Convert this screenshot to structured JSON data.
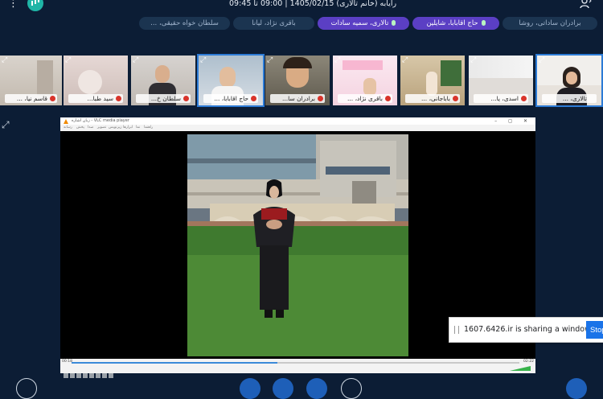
{
  "header": {
    "session_title": "رایابه (خانم تالاری) 1405/02/15 | 09:00 تا 09:45",
    "menu_icon": "more-vertical-icon",
    "logo_icon": "app-logo-icon",
    "user_icon": "user-settings-icon"
  },
  "presenters": [
    {
      "label": "برادران ساداتی، روشا",
      "style": "plain",
      "mic": false
    },
    {
      "label": "حاج اقابابا، شایلین",
      "style": "purple",
      "mic": true
    },
    {
      "label": "تالاری، سمیه سادات",
      "style": "purple",
      "mic": true
    },
    {
      "label": "باقری نژاد، لیانا",
      "style": "plain",
      "mic": false
    },
    {
      "label": "سلطان خواه حقیقی، ...",
      "style": "plain",
      "mic": false
    }
  ],
  "tiles": [
    {
      "label": "تالاری، ...",
      "muted": false,
      "active": true
    },
    {
      "label": "اسدی، یا...",
      "muted": true,
      "active": false
    },
    {
      "label": "باباجانی، ...",
      "muted": true,
      "active": false
    },
    {
      "label": "باقری نژاد، ...",
      "muted": true,
      "active": false
    },
    {
      "label": "برادران سا...",
      "muted": true,
      "active": false
    },
    {
      "label": "حاج اقابابا، ...",
      "muted": true,
      "active": false
    },
    {
      "label": "سلطان خ...",
      "muted": true,
      "active": false
    },
    {
      "label": "سید طبا...",
      "muted": true,
      "active": false
    },
    {
      "label": "قاسم نیا، ...",
      "muted": true,
      "active": false
    }
  ],
  "screen_share": {
    "window_title": "زبان اشاره - VLC media player",
    "menu_items": [
      "رسانه",
      "پخش",
      "صدا",
      "تصویر",
      "زیرنویس",
      "ابزارها",
      "نما",
      "راهنما"
    ],
    "time_elapsed": "00:18",
    "time_total": "02:22",
    "progress": 0.46,
    "volume": 1.0
  },
  "share_notice": {
    "message": "1607.6426.ir is sharing a window.",
    "stop_label": "Stop"
  },
  "colors": {
    "background": "#0c1d35",
    "accent_purple": "#5b3fc4",
    "accent_blue": "#1e5fb8",
    "active_tile_border": "#2c7bd6"
  }
}
